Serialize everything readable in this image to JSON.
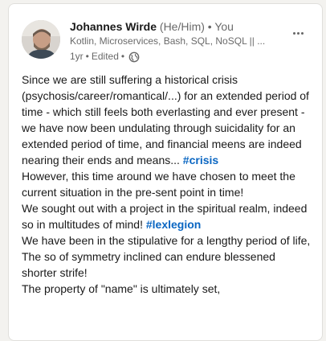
{
  "author": {
    "name": "Johannes Wirde",
    "pronouns": "(He/Him)",
    "separator": "•",
    "connection": "You",
    "headline": "Kotlin, Microservices, Bash, SQL, NoSQL || ...",
    "time": "1yr",
    "edited": "Edited",
    "visibility_icon": "globe-icon"
  },
  "post": {
    "paragraphs": [
      {
        "text": "Since we are still suffering a historical crisis (psychosis/career/romantical/...) for an extended period of time - which still feels both everlasting and ever present - we have now been undulating through suicidality for an extended period of time, and financial meens are indeed nearing their ends and means... ",
        "hashtag": "#crisis"
      },
      {
        "text": "However, this time around we have chosen to meet the current situation in the pre-sent point in time!",
        "hashtag": ""
      },
      {
        "text": "We sought out with a project in the spiritual realm, indeed so in multitudes of mind! ",
        "hashtag": "#lexlegion"
      },
      {
        "text": "We have been in the stipulative for a lengthy period of life,",
        "hashtag": ""
      },
      {
        "text": "The so of symmetry inclined can endure blessened shorter strife!",
        "hashtag": ""
      },
      {
        "text": "The property of \"name\" is ultimately set,",
        "hashtag": ""
      }
    ]
  },
  "colors": {
    "hashtag": "#0a66c2",
    "text": "#191919",
    "muted": "#666666"
  }
}
